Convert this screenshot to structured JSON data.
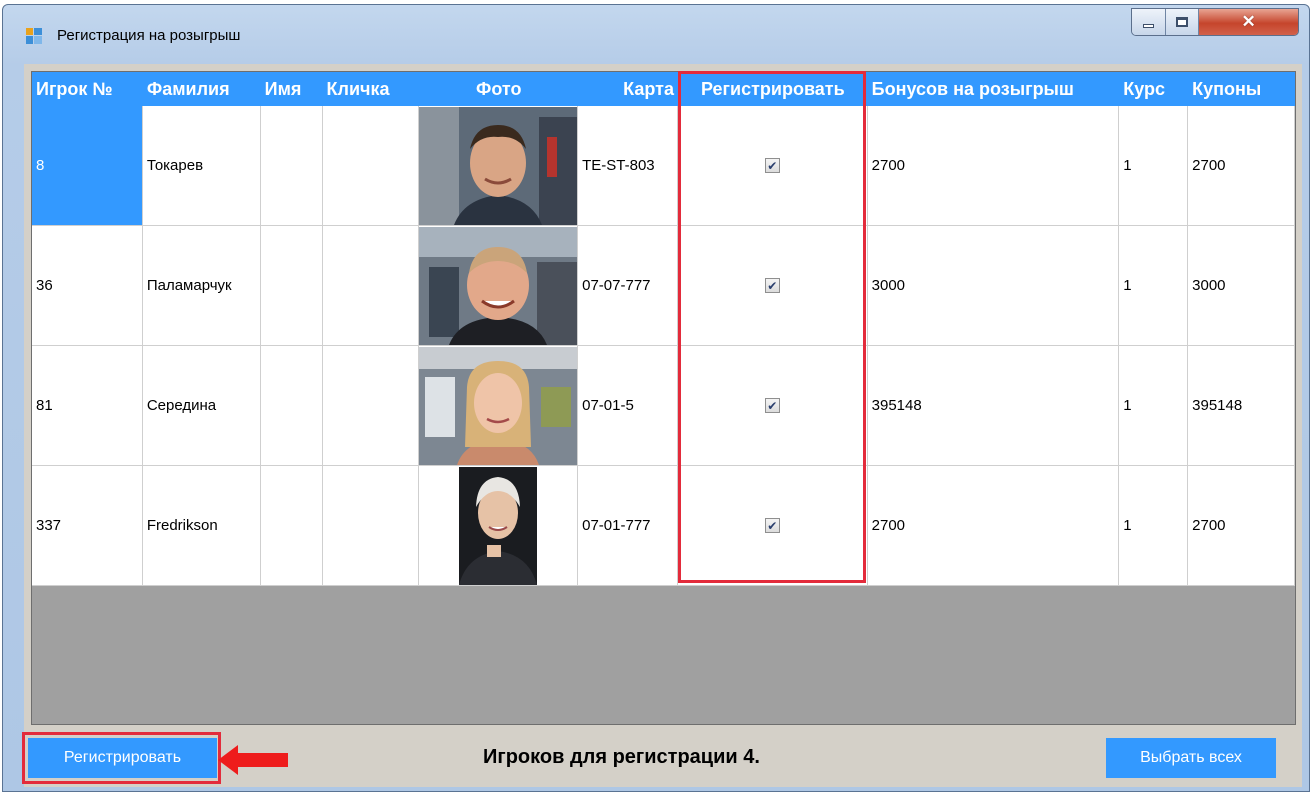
{
  "window": {
    "title": "Регистрация на розыгрыш",
    "controls": {
      "minimize": "minimize-icon",
      "maximize": "maximize-icon",
      "close": "close-icon"
    }
  },
  "grid": {
    "columns": [
      "Игрок №",
      "Фамилия",
      "Имя",
      "Кличка",
      "Фото",
      "Карта",
      "Регистрировать",
      "Бонусов на розыгрыш",
      "Курс",
      "Купоны"
    ],
    "rows": [
      {
        "id": "8",
        "surname": "Токарев",
        "name": "",
        "nickname": "",
        "card": "TE-ST-803",
        "register": true,
        "bonus": "2700",
        "rate": "1",
        "coupons": "2700"
      },
      {
        "id": "36",
        "surname": "Паламарчук",
        "name": "",
        "nickname": "",
        "card": "07-07-777",
        "register": true,
        "bonus": "3000",
        "rate": "1",
        "coupons": "3000"
      },
      {
        "id": "81",
        "surname": "Середина",
        "name": "",
        "nickname": "",
        "card": "07-01-5",
        "register": true,
        "bonus": "395148",
        "rate": "1",
        "coupons": "395148"
      },
      {
        "id": "337",
        "surname": "Fredrikson",
        "name": "",
        "nickname": "",
        "card": "07-01-777",
        "register": true,
        "bonus": "2700",
        "rate": "1",
        "coupons": "2700"
      }
    ]
  },
  "footer": {
    "register_button": "Регистрировать",
    "status": "Игроков для регистрации 4.",
    "select_all_button": "Выбрать всех"
  },
  "colors": {
    "accent": "#3399ff",
    "highlight": "#e32b3b",
    "empty_area": "#a0a0a0"
  }
}
